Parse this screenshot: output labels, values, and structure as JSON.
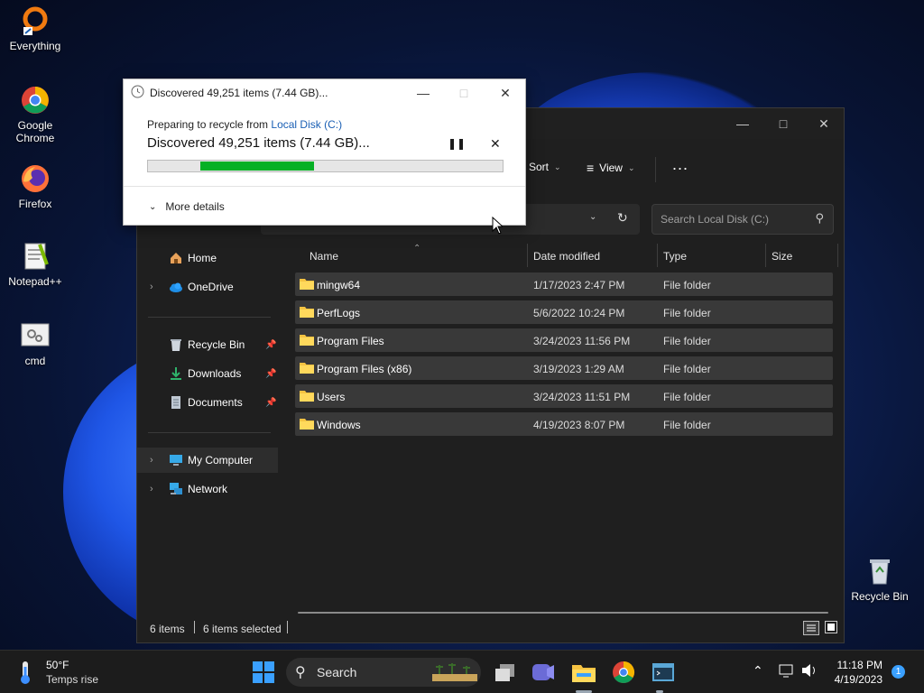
{
  "desktop": {
    "icons": [
      {
        "label": "Everything"
      },
      {
        "label": "Google Chrome"
      },
      {
        "label": "Firefox"
      },
      {
        "label": "Notepad++"
      },
      {
        "label": "cmd"
      },
      {
        "label": "Recycle Bin"
      }
    ]
  },
  "dialog": {
    "title": "Discovered 49,251 items (7.44 GB)...",
    "sub_prefix": "Preparing to recycle from ",
    "sub_link": "Local Disk (C:)",
    "main_text": "Discovered 49,251 items (7.44 GB)...",
    "progress_fraction": 0.32,
    "more_details": "More details",
    "accent_color": "#06b025"
  },
  "explorer": {
    "toolbar": {
      "sort": "Sort",
      "view": "View",
      "more": "..."
    },
    "search_placeholder": "Search Local Disk (C:)",
    "nav": {
      "home": "Home",
      "onedrive": "OneDrive",
      "recycle_bin": "Recycle Bin",
      "downloads": "Downloads",
      "documents": "Documents",
      "my_computer": "My Computer",
      "network": "Network"
    },
    "columns": {
      "name": "Name",
      "date": "Date modified",
      "type": "Type",
      "size": "Size"
    },
    "rows": [
      {
        "name": "mingw64",
        "date": "1/17/2023 2:47 PM",
        "type": "File folder"
      },
      {
        "name": "PerfLogs",
        "date": "5/6/2022 10:24 PM",
        "type": "File folder"
      },
      {
        "name": "Program Files",
        "date": "3/24/2023 11:56 PM",
        "type": "File folder"
      },
      {
        "name": "Program Files (x86)",
        "date": "3/19/2023 1:29 AM",
        "type": "File folder"
      },
      {
        "name": "Users",
        "date": "3/24/2023 11:51 PM",
        "type": "File folder"
      },
      {
        "name": "Windows",
        "date": "4/19/2023 8:07 PM",
        "type": "File folder"
      }
    ],
    "status": {
      "count": "6 items",
      "selected": "6 items selected"
    }
  },
  "taskbar": {
    "weather_temp": "50°F",
    "weather_desc": "Temps rise",
    "search_label": "Search",
    "time": "11:18 PM",
    "date": "4/19/2023",
    "notification_count": "1"
  }
}
